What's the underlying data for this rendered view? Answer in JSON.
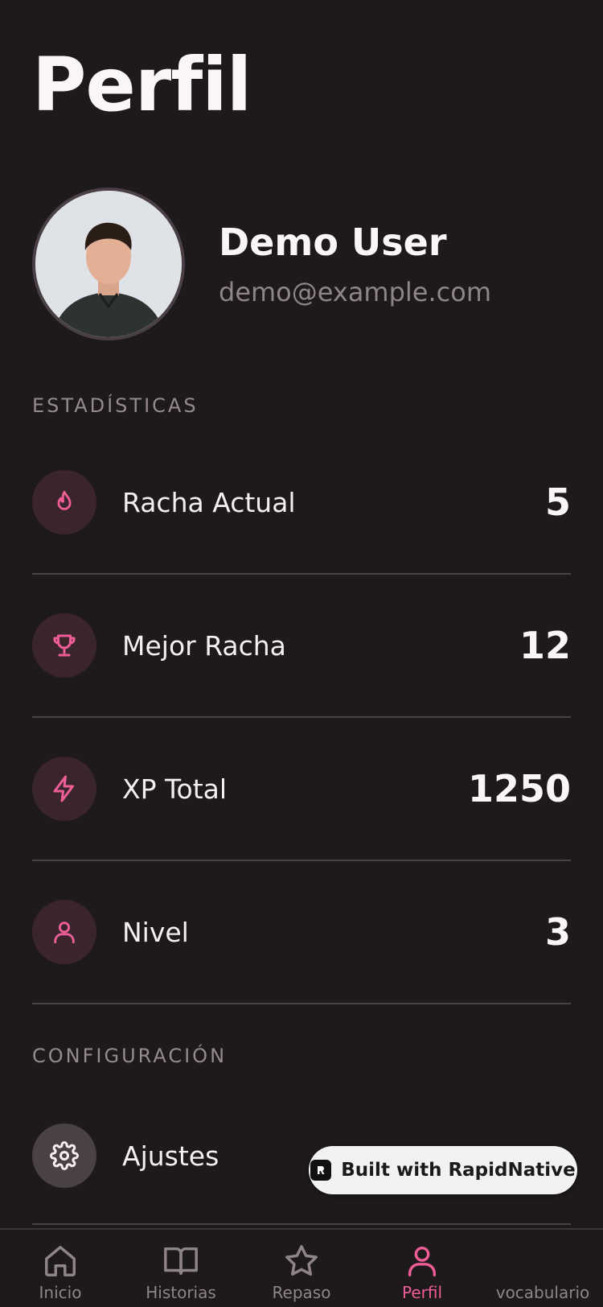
{
  "header": {
    "title": "Perfil"
  },
  "profile": {
    "name": "Demo User",
    "email": "demo@example.com"
  },
  "stats_section": {
    "label": "ESTADÍSTICAS",
    "items": [
      {
        "icon": "flame-icon",
        "label": "Racha Actual",
        "value": "5"
      },
      {
        "icon": "trophy-icon",
        "label": "Mejor Racha",
        "value": "12"
      },
      {
        "icon": "lightning-icon",
        "label": "XP Total",
        "value": "1250"
      },
      {
        "icon": "user-icon",
        "label": "Nivel",
        "value": "3"
      }
    ]
  },
  "config_section": {
    "label": "CONFIGURACIÓN",
    "items": [
      {
        "icon": "gear-icon",
        "label": "Ajustes"
      }
    ]
  },
  "badge": {
    "text": "Built with RapidNative"
  },
  "tabs": [
    {
      "label": "Inicio",
      "icon": "home-icon"
    },
    {
      "label": "Historias",
      "icon": "book-icon"
    },
    {
      "label": "Repaso",
      "icon": "star-icon"
    },
    {
      "label": "Perfil",
      "icon": "user-icon",
      "active": true
    },
    {
      "label": "vocabulario",
      "icon": ""
    }
  ],
  "colors": {
    "accent": "#ee5d95",
    "background": "#1e191b",
    "muted": "#8e8489"
  }
}
